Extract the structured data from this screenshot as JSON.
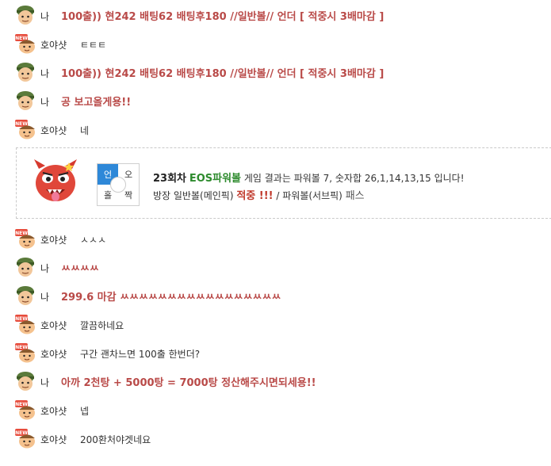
{
  "messages": [
    {
      "kind": "me",
      "avatar": "soldier-avatar",
      "nick": "나",
      "text": "100출)) 현242 배팅62 배팅후180 //일반볼// 언더 [ 적중시 3배마감 ]"
    },
    {
      "kind": "other",
      "avatar": "new-avatar",
      "nick": "호야샷",
      "text": "ㅌㅌㅌ"
    },
    {
      "kind": "me",
      "avatar": "soldier-avatar",
      "nick": "나",
      "text": "100출)) 현242 배팅62 배팅후180 //일반볼// 언더 [ 적중시 3배마감 ]"
    },
    {
      "kind": "me",
      "avatar": "soldier-avatar",
      "nick": "나",
      "text": "공 보고올게용!!"
    },
    {
      "kind": "other",
      "avatar": "new-avatar",
      "nick": "호야샷",
      "text": "네"
    },
    {
      "kind": "other",
      "avatar": "new-avatar",
      "nick": "호야샷",
      "text": "ㅅㅅㅅ"
    },
    {
      "kind": "me",
      "avatar": "soldier-avatar",
      "nick": "나",
      "text": "ㅆㅆㅆㅆ"
    },
    {
      "kind": "me",
      "avatar": "soldier-avatar",
      "nick": "나",
      "text": "299.6 마감 ㅆㅆㅆㅆㅆㅆㅆㅆㅆㅆㅆㅆㅆㅆㅆㅆㅆ"
    },
    {
      "kind": "other",
      "avatar": "new-avatar",
      "nick": "호야샷",
      "text": "깔끔하네요"
    },
    {
      "kind": "other",
      "avatar": "new-avatar",
      "nick": "호야샷",
      "text": "구간 괜차느면 100출 한번더?"
    },
    {
      "kind": "me",
      "avatar": "soldier-avatar",
      "nick": "나",
      "text": "아까 2천탕 + 5000탕 = 7000탕 정산해주시면되세용!!"
    },
    {
      "kind": "other",
      "avatar": "new-avatar",
      "nick": "호야샷",
      "text": "넵"
    },
    {
      "kind": "other",
      "avatar": "new-avatar",
      "nick": "호야샷",
      "text": "200환처야겟네요"
    }
  ],
  "result_card": {
    "round": "23회차",
    "game": "EOS파워볼",
    "result_text": "게임 결과는 파워볼 7, 숫자합 26,1,14,13,15 입니다!",
    "line2_prefix": "방장 일반볼(메인픽)",
    "line2_hit": "적중 !!!",
    "line2_mid": "/ 파워볼(서브픽)",
    "line2_pass": "패스",
    "grid": {
      "tl": "언",
      "tr": "오",
      "bl": "홀",
      "br": "짝"
    },
    "active_cell": "tl"
  },
  "colors": {
    "me_text": "#b94a48",
    "game_green": "#2e8b2e",
    "hit_red": "#c0392b",
    "active_blue": "#2e88d8"
  }
}
